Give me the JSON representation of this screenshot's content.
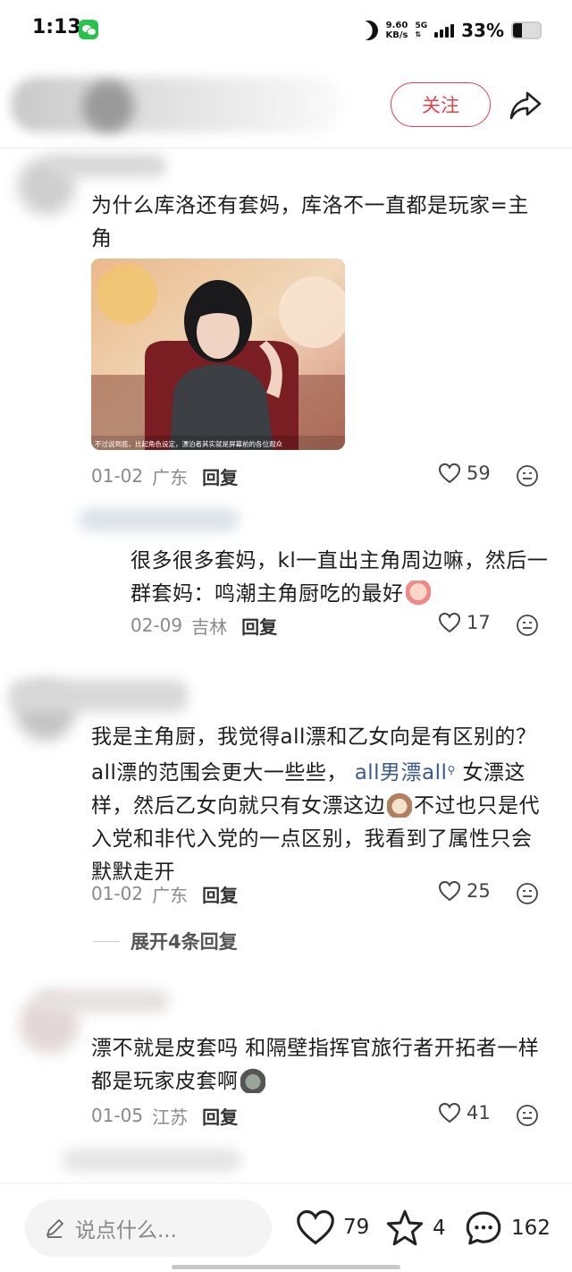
{
  "status_bar": {
    "time": "1:13",
    "net_speed_value": "9.60",
    "net_speed_unit": "KB/s",
    "network": "5G",
    "battery": "33%",
    "battery_level": 0.33
  },
  "header": {
    "follow_label": "关注"
  },
  "comments": [
    {
      "text": "为什么库洛还有套妈，库洛不一直都是玩家=主角",
      "image_caption": "不过说到底，比起角色设定，漂泊者其实就是屏幕前的各位观众",
      "date": "01-02",
      "location": "广东",
      "reply_label": "回复",
      "likes": "59"
    },
    {
      "text": "很多很多套妈，kl一直出主角周边嘛，然后一群套妈：鸣潮主角厨吃的最好",
      "date": "02-09",
      "location": "吉林",
      "reply_label": "回复",
      "likes": "17"
    },
    {
      "text_a": "我是主角厨，我觉得all漂和乙女向是有区别的？all漂的范围会更大一些些，",
      "link": "all男漂all",
      "text_b": "女漂这样，然后乙女向就只有女漂这边",
      "text_c": "不过也只是代入党和非代入党的一点区别，我看到了属性只会默默走开",
      "date": "01-02",
      "location": "广东",
      "reply_label": "回复",
      "likes": "25",
      "expand_label": "展开4条回复"
    },
    {
      "text": "漂不就是皮套吗 和隔壁指挥官旅行者开拓者一样都是玩家皮套啊",
      "date": "01-05",
      "location": "江苏",
      "reply_label": "回复",
      "likes": "41"
    }
  ],
  "bottom_bar": {
    "input_placeholder": "说点什么...",
    "likes": "79",
    "favorites": "4",
    "comments": "162"
  },
  "colors": {
    "accent": "#e0434f",
    "link": "#3a5a8c",
    "meta": "#8a8a8a"
  }
}
